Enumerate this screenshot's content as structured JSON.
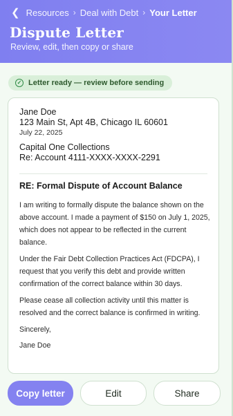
{
  "breadcrumb": {
    "back_icon": "chevron-left-icon",
    "items": [
      "Resources",
      "Deal with Debt",
      "Your Letter"
    ],
    "separator": "›"
  },
  "header": {
    "title": "Dispute Letter",
    "subtitle": "Review, edit, then copy or share"
  },
  "status": {
    "icon": "check-circle-icon",
    "text": "Letter ready — review before sending"
  },
  "letter": {
    "sender_name": "Jane Doe",
    "sender_address": "123 Main St, Apt 4B, Chicago IL 60601",
    "date": "July 22, 2025",
    "recipient": "Capital One Collections",
    "account": "Re: Account 4111-XXXX-XXXX-2291",
    "subject": "RE: Formal Dispute of Account Balance",
    "paragraphs": [
      "I am writing to formally dispute the balance shown on the above account. I made a payment of $150 on July 1, 2025, which does not appear to be reflected in the current balance.",
      "Under the Fair Debt Collection Practices Act (FDCPA), I request that you verify this debt and provide written confirmation of the correct balance within 30 days.",
      "Please cease all collection activity until this matter is resolved and the correct balance is confirmed in writing."
    ],
    "closing": "Sincerely,",
    "signature": "Jane Doe"
  },
  "actions": {
    "copy": "Copy letter",
    "edit": "Edit",
    "share": "Share"
  },
  "colors": {
    "accent": "#8482f0",
    "header_bg": "#7f7ff0",
    "page_bg": "#f3faf3",
    "badge_bg": "#d9efd9",
    "success": "#2e8b45"
  }
}
